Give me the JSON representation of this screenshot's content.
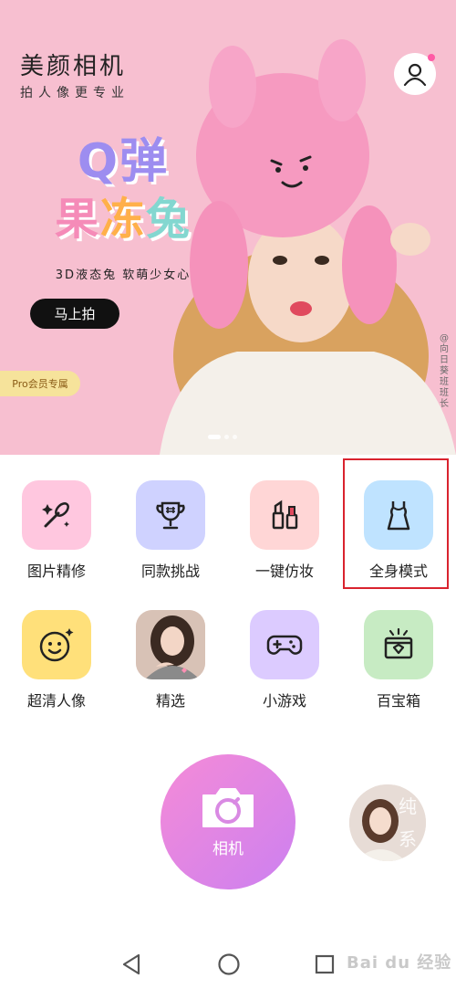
{
  "header": {
    "app_title": "美颜相机",
    "app_subtitle": "拍人像更专业",
    "profile_icon": "user-icon"
  },
  "banner": {
    "promo_line1": "Q弹",
    "promo_line2": [
      "果",
      "冻",
      "兔"
    ],
    "promo_subtitle": "3D液态兔  软萌少女心",
    "cta_label": "马上拍",
    "pro_badge": "Pro会员专属",
    "author_credit": "@向日葵班班长",
    "slide_count": 3,
    "active_slide": 1
  },
  "features": [
    {
      "label": "图片精修",
      "icon": "makeup-brush-icon",
      "bg": "#ffc7df"
    },
    {
      "label": "同款挑战",
      "icon": "trophy-icon",
      "bg": "#cfd2ff"
    },
    {
      "label": "一键仿妆",
      "icon": "lipstick-icon",
      "bg": "#ffd6d6"
    },
    {
      "label": "全身模式",
      "icon": "dress-icon",
      "bg": "#bfe3ff"
    },
    {
      "label": "超清人像",
      "icon": "smiley-face-icon",
      "bg": "#ffe07a"
    },
    {
      "label": "精选",
      "icon": "portrait-photo",
      "bg": "#e8c9bf"
    },
    {
      "label": "小游戏",
      "icon": "gamepad-icon",
      "bg": "#dccbff"
    },
    {
      "label": "百宝箱",
      "icon": "treasure-box-icon",
      "bg": "#c7ebc3"
    }
  ],
  "camera": {
    "label": "相机",
    "icon": "camera-icon"
  },
  "pure_filter": {
    "text": "纯系"
  },
  "nav": {
    "back_icon": "back-triangle-icon",
    "home_icon": "home-circle-icon",
    "recents_icon": "recents-square-icon"
  },
  "watermark": "Bai du 经验",
  "colors": {
    "banner_bg": "#f7bfd0",
    "camera_gradient_start": "#f58bd7",
    "camera_gradient_end": "#cc80f0",
    "highlight": "#d9232e"
  }
}
